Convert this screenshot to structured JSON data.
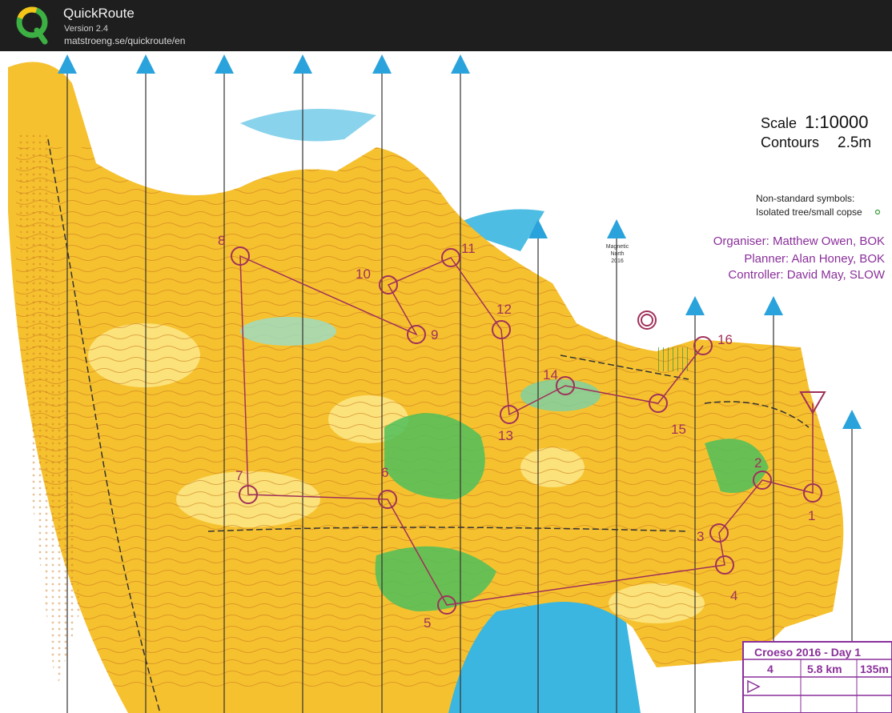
{
  "app": {
    "title": "QuickRoute",
    "version": "Version 2.4",
    "url": "matstroeng.se/quickroute/en"
  },
  "map": {
    "scale_label": "Scale",
    "scale_value": "1:10000",
    "contours_label": "Contours",
    "contours_value": "2.5m",
    "nonstandard_title": "Non-standard symbols:",
    "nonstandard_item": "Isolated tree/small copse",
    "organiser": "Organiser: Matthew Owen, BOK",
    "planner": "Planner: Alan Honey, BOK",
    "controller": "Controller: David May, SLOW",
    "magnetic_north": [
      "Magnetic",
      "North",
      "2016"
    ],
    "event_title": "Croeso 2016 - Day 1",
    "course_number": "4",
    "course_length": "5.8 km",
    "course_climb": "135m",
    "colors": {
      "open_land": "#f6c12f",
      "rough_open": "#fbe27a",
      "forest": "#ffffff",
      "green": "#4fbf5a",
      "water": "#3bb6e0",
      "contour": "#c8781e",
      "course": "#a0305a",
      "north_arrow": "#2aa3dc",
      "header_purple": "#8a2f9a"
    },
    "controls": [
      {
        "label": "1"
      },
      {
        "label": "2"
      },
      {
        "label": "3"
      },
      {
        "label": "4"
      },
      {
        "label": "5"
      },
      {
        "label": "6"
      },
      {
        "label": "7"
      },
      {
        "label": "8"
      },
      {
        "label": "9"
      },
      {
        "label": "10"
      },
      {
        "label": "11"
      },
      {
        "label": "12"
      },
      {
        "label": "13"
      },
      {
        "label": "14"
      },
      {
        "label": "15"
      },
      {
        "label": "16"
      }
    ]
  }
}
